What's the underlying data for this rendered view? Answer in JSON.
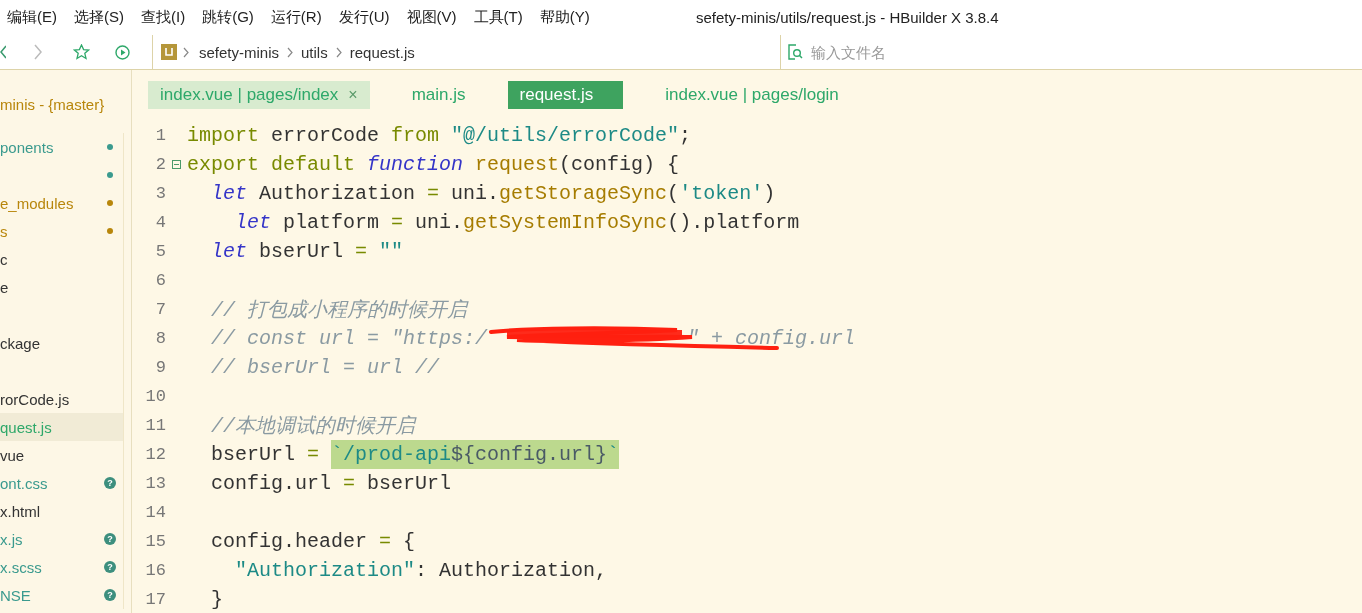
{
  "menu": [
    "编辑(E)",
    "选择(S)",
    "查找(I)",
    "跳转(G)",
    "运行(R)",
    "发行(U)",
    "视图(V)",
    "工具(T)",
    "帮助(Y)"
  ],
  "window": {
    "title": "sefety-minis/utils/request.js - HBuilder X 3.8.4"
  },
  "breadcrumb": [
    "sefety-minis",
    "utils",
    "request.js"
  ],
  "file_search": {
    "placeholder": "输入文件名"
  },
  "sidebar": {
    "project": "minis - {master}",
    "items": [
      {
        "kind": "item",
        "label": "ponents",
        "color": "#3a9a8e",
        "dot": true,
        "selected": false
      },
      {
        "kind": "item",
        "color": "#3a9a8e",
        "dot": true,
        "selected": false
      },
      {
        "kind": "item",
        "label": "e_modules",
        "color": "#b8860b",
        "dot": true,
        "selected": false
      },
      {
        "kind": "item",
        "label": "s",
        "color": "#b8860b",
        "dot": true,
        "selected": false
      },
      {
        "kind": "item",
        "label": "c",
        "color": "#333333",
        "dot": false,
        "selected": false
      },
      {
        "kind": "item",
        "label": "e",
        "color": "#333333",
        "dot": false,
        "selected": false
      },
      {
        "kind": "blank"
      },
      {
        "kind": "item",
        "label": "ckage",
        "color": "#333333",
        "dot": false,
        "selected": false
      },
      {
        "kind": "blank"
      },
      {
        "kind": "item",
        "label": "rorCode.js",
        "color": "#333333",
        "dot": false,
        "selected": false
      },
      {
        "kind": "item",
        "label": "quest.js",
        "color": "#2ea86a",
        "dot": false,
        "selected": true
      },
      {
        "kind": "item",
        "label": "vue",
        "color": "#333333",
        "dot": false,
        "selected": false
      },
      {
        "kind": "item",
        "label": "ont.css",
        "color": "#3a9a8e",
        "dot": false,
        "badge": "?",
        "selected": false
      },
      {
        "kind": "item",
        "label": "x.html",
        "color": "#333333",
        "dot": false,
        "selected": false
      },
      {
        "kind": "item",
        "label": "x.js",
        "color": "#3a9a8e",
        "dot": false,
        "badge": "?",
        "selected": false
      },
      {
        "kind": "item",
        "label": "x.scss",
        "color": "#3a9a8e",
        "dot": false,
        "badge": "?",
        "selected": false
      },
      {
        "kind": "item",
        "label": "NSE",
        "color": "#3a9a8e",
        "dot": false,
        "badge": "?",
        "selected": false
      }
    ]
  },
  "tabs": [
    {
      "label": "index.vue | pages/index",
      "selected": false,
      "hovered": true,
      "close": "×"
    },
    {
      "label": "main.js",
      "selected": false,
      "hovered": false
    },
    {
      "label": "request.js",
      "selected": true,
      "hovered": false
    },
    {
      "label": "index.vue | pages/login",
      "selected": false,
      "hovered": false
    }
  ],
  "code": [
    {
      "number": "1",
      "foldable": false,
      "tokens": [
        {
          "kind": "kw",
          "text": "import"
        },
        {
          "kind": "pl",
          "text": " errorCode "
        },
        {
          "kind": "kw",
          "text": "from"
        },
        {
          "kind": "str",
          "text": " \"@/utils/errorCode\""
        },
        {
          "kind": "pl",
          "text": ";"
        }
      ]
    },
    {
      "number": "2",
      "foldable": true,
      "tokens": [
        {
          "kind": "kw",
          "text": "export default"
        },
        {
          "kind": "it",
          "text": " function"
        },
        {
          "kind": "fn",
          "text": " request"
        },
        {
          "kind": "pl",
          "text": "(config) {"
        }
      ]
    },
    {
      "number": "3",
      "foldable": false,
      "tokens": [
        {
          "kind": "it",
          "text": "  let"
        },
        {
          "kind": "pl",
          "text": " Authorization "
        },
        {
          "kind": "op",
          "text": "="
        },
        {
          "kind": "pl",
          "text": " uni."
        },
        {
          "kind": "fn",
          "text": "getStorageSync"
        },
        {
          "kind": "pl",
          "text": "("
        },
        {
          "kind": "str",
          "text": "'token'"
        },
        {
          "kind": "pl",
          "text": ")"
        }
      ]
    },
    {
      "number": "4",
      "foldable": false,
      "tokens": [
        {
          "kind": "it",
          "text": "    let"
        },
        {
          "kind": "pl",
          "text": " platform "
        },
        {
          "kind": "op",
          "text": "="
        },
        {
          "kind": "pl",
          "text": " uni."
        },
        {
          "kind": "fn",
          "text": "getSystemInfoSync"
        },
        {
          "kind": "pl",
          "text": "().platform"
        }
      ]
    },
    {
      "number": "5",
      "foldable": false,
      "tokens": [
        {
          "kind": "it",
          "text": "  let"
        },
        {
          "kind": "pl",
          "text": " bserUrl "
        },
        {
          "kind": "op",
          "text": "="
        },
        {
          "kind": "str",
          "text": " \"\""
        }
      ]
    },
    {
      "number": "6",
      "foldable": false
    },
    {
      "number": "7",
      "foldable": false,
      "tokens": [
        {
          "kind": "cm",
          "text": "  // 打包成小程序的时候开启"
        }
      ]
    },
    {
      "number": "8",
      "foldable": false,
      "tokens": [
        {
          "kind": "cm",
          "text": "  // const url = \"https:/"
        },
        {
          "kind": "redacted"
        },
        {
          "kind": "cm",
          "text": "\" + config.url"
        }
      ]
    },
    {
      "number": "9",
      "foldable": false,
      "tokens": [
        {
          "kind": "cm",
          "text": "  // bserUrl = url //"
        }
      ]
    },
    {
      "number": "10",
      "foldable": false
    },
    {
      "number": "11",
      "foldable": false,
      "tokens": [
        {
          "kind": "cm",
          "text": "  //本地调试的时候开启"
        }
      ]
    },
    {
      "number": "12",
      "foldable": false,
      "tokens": [
        {
          "kind": "pl",
          "text": "  bserUrl "
        },
        {
          "kind": "op",
          "text": "= "
        },
        {
          "kind": "hl",
          "text": "`/prod-api"
        },
        {
          "kind": "hlx",
          "text": "${config.url}"
        },
        {
          "kind": "hl",
          "text": "`"
        }
      ]
    },
    {
      "number": "13",
      "foldable": false,
      "tokens": [
        {
          "kind": "pl",
          "text": "  config.url "
        },
        {
          "kind": "op",
          "text": "="
        },
        {
          "kind": "pl",
          "text": " bserUrl"
        }
      ]
    },
    {
      "number": "14",
      "foldable": false
    },
    {
      "number": "15",
      "foldable": false,
      "tokens": [
        {
          "kind": "pl",
          "text": "  config.header "
        },
        {
          "kind": "op",
          "text": "="
        },
        {
          "kind": "pl",
          "text": " {"
        }
      ]
    },
    {
      "number": "16",
      "foldable": false,
      "tokens": [
        {
          "kind": "str",
          "text": "    \"Authorization\""
        },
        {
          "kind": "pl",
          "text": ": Authorization,"
        }
      ]
    },
    {
      "number": "17",
      "foldable": false,
      "tokens": [
        {
          "kind": "pl",
          "text": "  }"
        }
      ]
    }
  ]
}
